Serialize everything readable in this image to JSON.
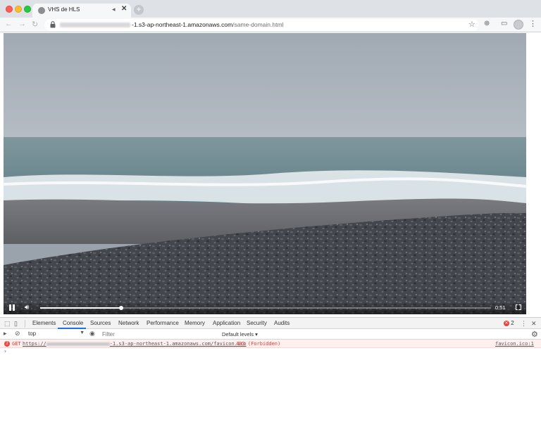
{
  "browser": {
    "tab_title": "VHS de HLS",
    "tab_close_glyph": "✕",
    "new_tab_glyph": "+",
    "url_host_suffix": "-1.s3-ap-northeast-1.amazonaws.com",
    "url_path": "/same-domain.html"
  },
  "video": {
    "current_time": "0:51",
    "played_fraction": 0.18,
    "sky_color": "#a7afb8",
    "sea_color": "#6f8b92",
    "foam_color": "#e6ecef",
    "sand_color": "#6b6c70",
    "pebble_color": "#3e4147"
  },
  "devtools": {
    "tabs": [
      "Elements",
      "Console",
      "Sources",
      "Network",
      "Performance",
      "Memory",
      "Application",
      "Security",
      "Audits"
    ],
    "active_tab": "Console",
    "error_count": "2",
    "context": "top",
    "filter_placeholder": "Filter",
    "levels": "Default levels ▾",
    "console": {
      "error_badge": "2",
      "method": "GET",
      "url_prefix": "https://",
      "url_suffix": "-1.s3-ap-northeast-1.amazonaws.com/favicon.ico",
      "status": "403 (Forbidden)",
      "source": "favicon.ico:1",
      "prompt": "›"
    }
  },
  "icons": {
    "lock": "lock-icon",
    "star": "star-icon",
    "gear": "gear-icon"
  }
}
